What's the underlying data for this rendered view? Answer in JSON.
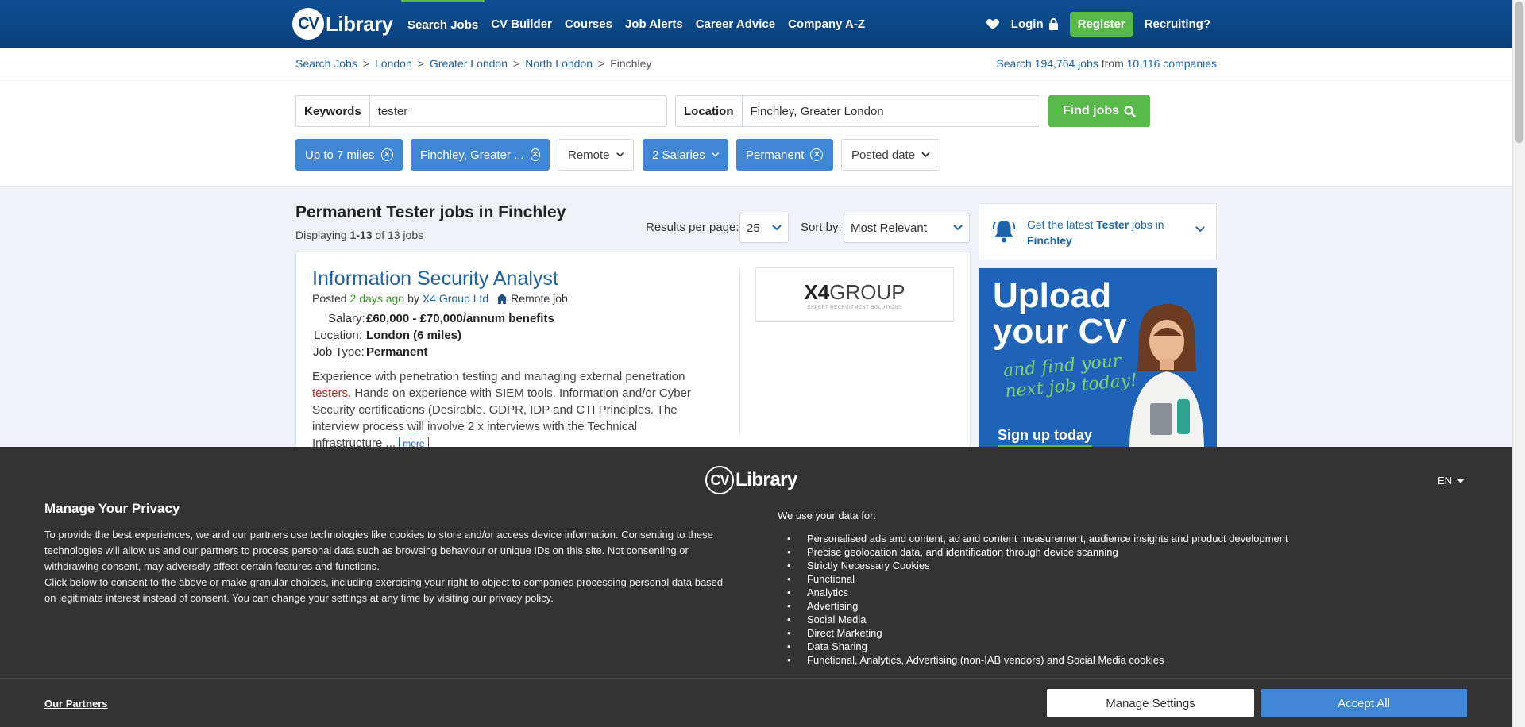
{
  "header": {
    "logo_text": "CV-Library",
    "nav": [
      "Search Jobs",
      "CV Builder",
      "Courses",
      "Job Alerts",
      "Career Advice",
      "Company A-Z"
    ],
    "login": "Login",
    "register": "Register",
    "recruiting": "Recruiting?"
  },
  "breadcrumb": [
    "Search Jobs",
    "London",
    "Greater London",
    "North London",
    "Finchley"
  ],
  "stats": {
    "prefix": "Search",
    "jobs_count": "194,764 jobs",
    "from": "from",
    "companies_count": "10,116 companies"
  },
  "search": {
    "keywords_label": "Keywords",
    "keywords_value": "tester",
    "location_label": "Location",
    "location_value": "Finchley, Greater London",
    "find_button": "Find jobs"
  },
  "filters": [
    {
      "label": "Up to 7 miles",
      "active": true
    },
    {
      "label": "Finchley, Greater ...",
      "active": true
    },
    {
      "label": "Remote",
      "active": false
    },
    {
      "label": "2 Salaries",
      "active": true
    },
    {
      "label": "Permanent",
      "active": true
    },
    {
      "label": "Posted date",
      "active": false
    }
  ],
  "results": {
    "title": "Permanent Tester jobs in Finchley",
    "displaying": "Displaying",
    "range": "1-13",
    "of_total": "of 13 jobs",
    "per_page_label": "Results per page:",
    "per_page_value": "25",
    "sort_label": "Sort by:",
    "sort_value": "Most Relevant"
  },
  "job": {
    "title": "Information Security Analyst",
    "posted": "Posted",
    "posted_ago": "2 days ago",
    "by": "by",
    "company": "X4 Group Ltd",
    "remote": "Remote job",
    "salary_label": "Salary:",
    "salary": "£60,000 - £70,000/annum benefits",
    "location_label": "Location:",
    "location": "London (6 miles)",
    "type_label": "Job Type:",
    "type": "Permanent",
    "desc_1": "Experience with penetration testing and managing external penetration ",
    "desc_hl": "testers",
    "desc_2": ". Hands on experience with SIEM tools. Information and/or Cyber Security certifications (Desirable. GDPR, IDP and CTI Principles. The interview process will involve 2 x interviews with the Technical Infrastructure ... ",
    "more": "more",
    "logo_main": "X4",
    "logo_rest": "GROUP",
    "logo_tag": "EXPERT RECRUITMENT SOLUTIONS"
  },
  "alert": {
    "pre": "Get the latest",
    "keyword": "Tester",
    "mid": "jobs in",
    "place": "Finchley"
  },
  "ad": {
    "headline_1": "Upload",
    "headline_2": "your CV",
    "sub_1": "and find your",
    "sub_2": "next job today!",
    "cta": "Sign up today"
  },
  "consent": {
    "logo_text": "CV-Library",
    "lang": "EN",
    "title": "Manage Your Privacy",
    "text_1": "To provide the best experiences, we and our partners use technologies like cookies to store and/or access device information. Consenting to these technologies will allow us and our partners to process personal data such as browsing behaviour or unique IDs on this site. Not consenting or withdrawing consent, may adversely affect certain features and functions.",
    "text_2": "Click below to consent to the above or make granular choices, including exercising your right to object to companies processing personal data based on legitimate interest instead of consent. You can change your settings at any time by visiting our privacy policy.",
    "uses_title": "We use your data for:",
    "uses": [
      "Personalised ads and content, ad and content measurement, audience insights and product development",
      "Precise geolocation data, and identification through device scanning",
      "Strictly Necessary Cookies",
      "Functional",
      "Analytics",
      "Advertising",
      "Social Media",
      "Direct Marketing",
      "Data Sharing",
      "Functional, Analytics, Advertising (non-IAB vendors) and Social Media cookies"
    ],
    "partners": "Our Partners",
    "manage": "Manage Settings",
    "accept": "Accept All"
  },
  "colors": {
    "header": "#0a3f7a",
    "accent_green": "#56b948",
    "chip_blue": "#3f86d4",
    "link": "#1d63a8",
    "consent_bg": "#333333"
  }
}
